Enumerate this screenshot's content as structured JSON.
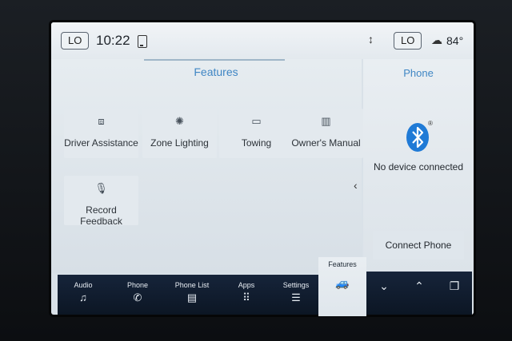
{
  "status": {
    "climate_left": "LO",
    "time": "10:22",
    "climate_right": "LO",
    "temperature": "84°"
  },
  "features": {
    "title": "Features",
    "tiles": [
      {
        "label": "Driver Assistance",
        "icon": "driver-assist-icon"
      },
      {
        "label": "Zone Lighting",
        "icon": "zone-lighting-icon"
      },
      {
        "label": "Towing",
        "icon": "towing-icon"
      },
      {
        "label": "Owner's Manual",
        "icon": "manual-book-icon"
      },
      {
        "label": "Record Feedback",
        "icon": "microphone-icon"
      }
    ]
  },
  "phone": {
    "title": "Phone",
    "status": "No device connected",
    "connect_label": "Connect Phone"
  },
  "nav": {
    "items": [
      {
        "label": "Audio",
        "icon": "music-note-icon"
      },
      {
        "label": "Phone",
        "icon": "handset-icon"
      },
      {
        "label": "Phone List",
        "icon": "phone-list-icon"
      },
      {
        "label": "Apps",
        "icon": "apps-grid-icon"
      },
      {
        "label": "Settings",
        "icon": "sliders-icon"
      }
    ],
    "active": {
      "label": "Features",
      "icon": "vehicle-icon"
    }
  },
  "colors": {
    "accent": "#3f86c4",
    "bluetooth": "#1f7ad6",
    "navbar": "#13213a"
  }
}
